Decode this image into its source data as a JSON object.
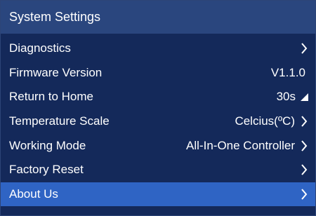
{
  "title": "System Settings",
  "items": [
    {
      "label": "Diagnostics",
      "value": ""
    },
    {
      "label": "Firmware Version",
      "value": "V1.1.0"
    },
    {
      "label": "Return to Home",
      "value": "30s"
    },
    {
      "label": "Temperature Scale",
      "value": "Celcius(ºC)"
    },
    {
      "label": "Working Mode",
      "value": "All-In-One Controller"
    },
    {
      "label": "Factory Reset",
      "value": ""
    },
    {
      "label": "About Us",
      "value": ""
    }
  ],
  "colors": {
    "background": "#14295a",
    "titlebar": "#2a467e",
    "selected_row": "#2f64c4",
    "text": "#ffffff"
  }
}
